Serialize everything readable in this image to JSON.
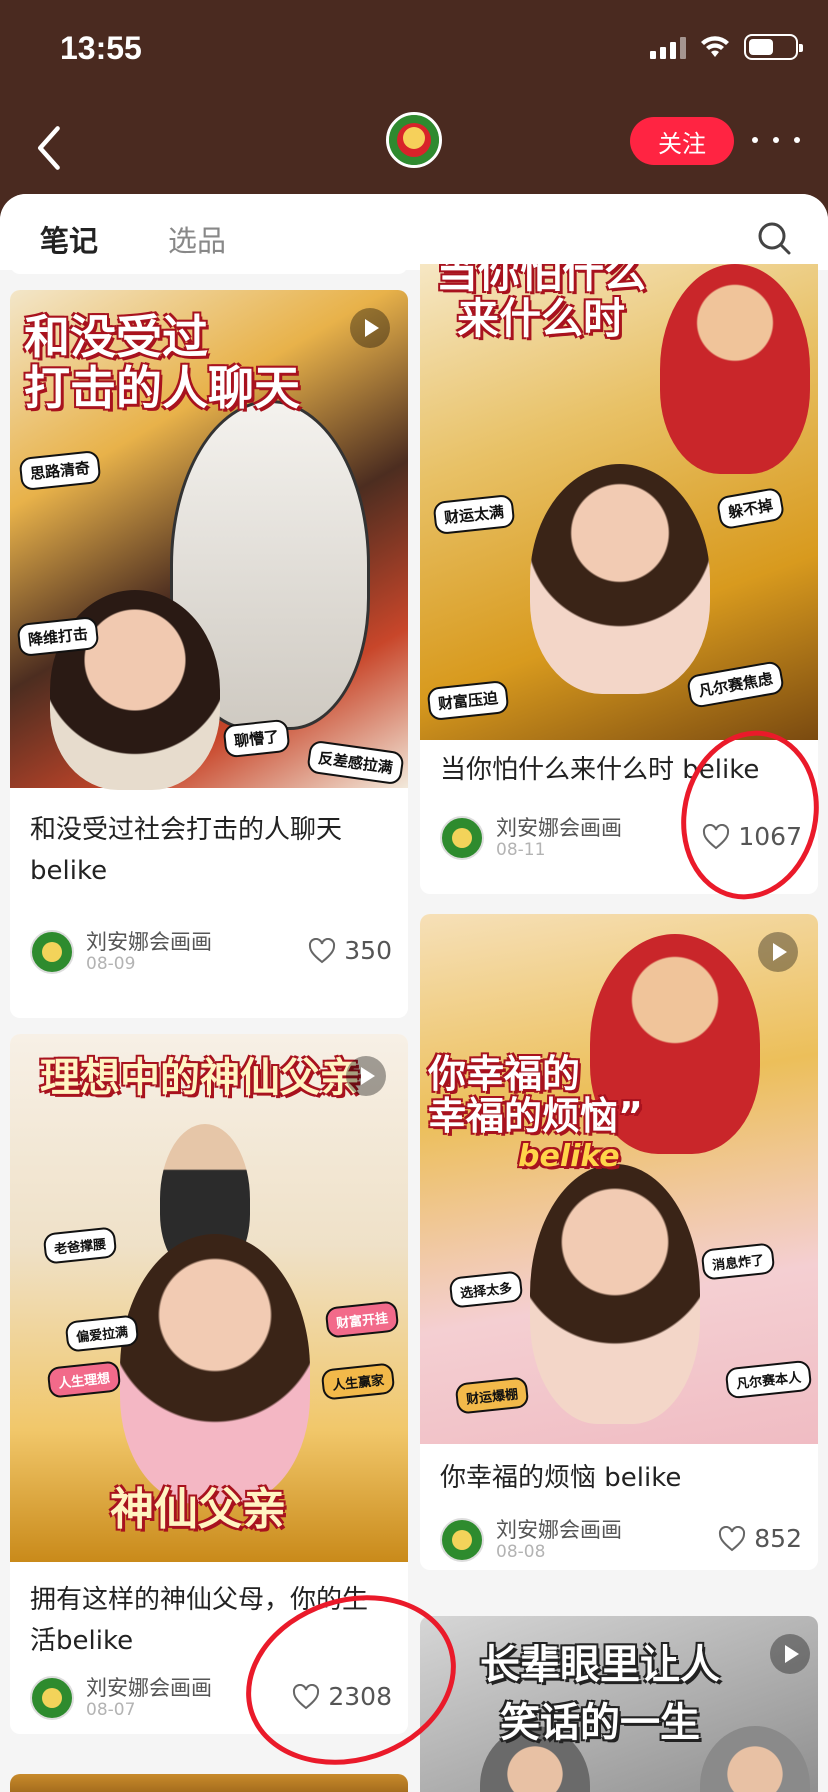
{
  "status": {
    "time": "13:55"
  },
  "header": {
    "follow_label": "关注"
  },
  "tabs": [
    {
      "label": "笔记"
    },
    {
      "label": "选品"
    }
  ],
  "author": {
    "name": "刘安娜会画画"
  },
  "notes": [
    {
      "title": "和没受过社会打击的人聊天belike",
      "date": "08-09",
      "likes": "350",
      "cover_title": "和没受过\n打击的人聊天",
      "stickers": [
        "思路清奇",
        "降维打击",
        "聊懵了",
        "反差感拉满"
      ]
    },
    {
      "title": "拥有这样的神仙父母，你的生活belike",
      "date": "08-07",
      "likes": "2308",
      "cover_title": "理想中的神仙父亲",
      "cover_footer": "神仙父亲",
      "stickers": [
        "老爸撑腰",
        "偏爱拉满",
        "人生理想",
        "财富开挂",
        "人生赢家"
      ]
    },
    {
      "title": "当你怕什么来什么时 belike",
      "date": "08-11",
      "likes": "1067",
      "cover_title": "当你怕什么\n来什么时",
      "stickers": [
        "财运太满",
        "躲不掉",
        "财富压迫",
        "凡尔赛焦虑"
      ]
    },
    {
      "title": "你幸福的烦恼 belike",
      "date": "08-08",
      "likes": "852",
      "cover_title": "你幸福的\n幸福的烦恼”",
      "cover_sub": "belike",
      "stickers": [
        "选择太多",
        "消息炸了",
        "财运爆棚",
        "凡尔赛本人"
      ]
    },
    {
      "cover_title": "长辈眼里让人\n笑话的一生"
    }
  ],
  "colors": {
    "brand_red": "#ff2442",
    "header_bg": "#4a2a20",
    "annotation_red": "#ea1a2a"
  }
}
